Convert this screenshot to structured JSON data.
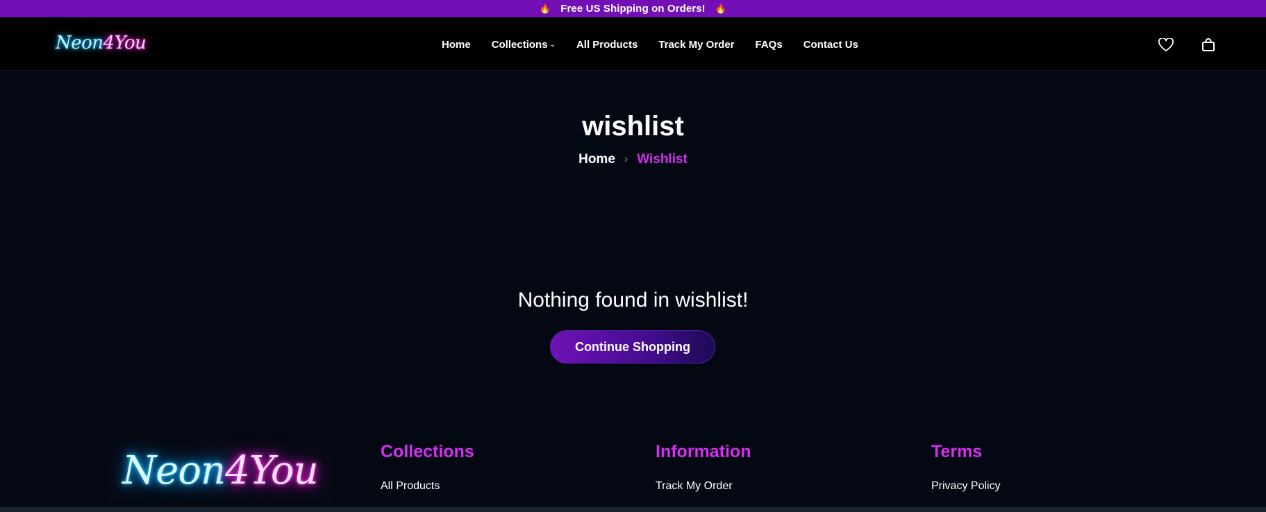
{
  "announcement": {
    "text": "Free US Shipping on Orders!",
    "icon": "fire-icon"
  },
  "header": {
    "logo": {
      "part1": "Neon",
      "part2": "4You"
    },
    "nav": [
      {
        "label": "Home"
      },
      {
        "label": "Collections",
        "has_dropdown": true
      },
      {
        "label": "All Products"
      },
      {
        "label": "Track My Order"
      },
      {
        "label": "FAQs"
      },
      {
        "label": "Contact Us"
      }
    ],
    "icons": [
      "heart-icon",
      "shopping-bag-icon"
    ]
  },
  "page": {
    "title": "wishlist",
    "breadcrumb": {
      "home": "Home",
      "separator": "›",
      "current": "Wishlist"
    },
    "empty_message": "Nothing found in wishlist!",
    "continue_button": "Continue Shopping"
  },
  "footer": {
    "logo": {
      "part1": "Neon",
      "part2": "4You"
    },
    "columns": [
      {
        "heading": "Collections",
        "first_link": "All Products"
      },
      {
        "heading": "Information",
        "first_link": "Track My Order"
      },
      {
        "heading": "Terms",
        "first_link": "Privacy Policy"
      }
    ]
  },
  "colors": {
    "announcement_bg": "#7210b5",
    "header_bg": "#000000",
    "page_bg": "#040812",
    "accent_pink": "#d62ff0",
    "button_gradient_start": "#6f12b8",
    "button_gradient_end": "#1c0a52",
    "neon_blue": "#27c8ff",
    "neon_pink": "#ff39e8"
  }
}
